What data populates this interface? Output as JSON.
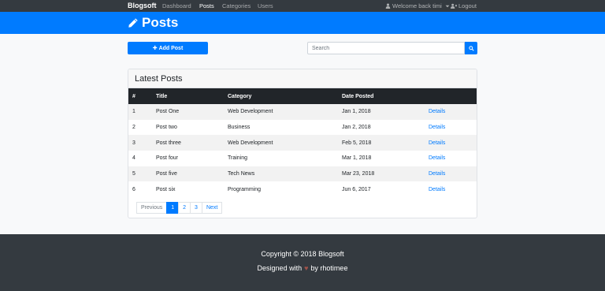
{
  "navbar": {
    "brand": "Blogsoft",
    "links": [
      {
        "label": "Dashboard",
        "active": false
      },
      {
        "label": "Posts",
        "active": true
      },
      {
        "label": "Categories",
        "active": false
      },
      {
        "label": "Users",
        "active": false
      }
    ],
    "welcome": "Welcome back timi",
    "logout": "Logout"
  },
  "header": {
    "title": "Posts",
    "icon": "pencil-icon"
  },
  "actions": {
    "add_post": "Add Post",
    "search_placeholder": "Search"
  },
  "card": {
    "title": "Latest Posts",
    "columns": [
      "#",
      "Title",
      "Category",
      "Date Posted",
      ""
    ],
    "rows": [
      {
        "num": "1",
        "title": "Post One",
        "category": "Web Development",
        "date": "Jan 1, 2018",
        "action": "Details"
      },
      {
        "num": "2",
        "title": "Post two",
        "category": "Business",
        "date": "Jan 2, 2018",
        "action": "Details"
      },
      {
        "num": "3",
        "title": "Post three",
        "category": "Web Development",
        "date": "Feb 5, 2018",
        "action": "Details"
      },
      {
        "num": "4",
        "title": "Post four",
        "category": "Training",
        "date": "Mar 1, 2018",
        "action": "Details"
      },
      {
        "num": "5",
        "title": "Post five",
        "category": "Tech News",
        "date": "Mar 23, 2018",
        "action": "Details"
      },
      {
        "num": "6",
        "title": "Post six",
        "category": "Programming",
        "date": "Jun 6, 2017",
        "action": "Details"
      }
    ]
  },
  "pagination": {
    "previous": "Previous",
    "pages": [
      "1",
      "2",
      "3"
    ],
    "active_page": "1",
    "next": "Next"
  },
  "footer": {
    "copyright": "Copyright © 2018 Blogsoft",
    "designed_prefix": "Designed with",
    "heart": "♥",
    "designed_suffix": "by rhotimee"
  },
  "colors": {
    "primary": "#007bff",
    "dark": "#343a40",
    "table_head": "#212529"
  }
}
